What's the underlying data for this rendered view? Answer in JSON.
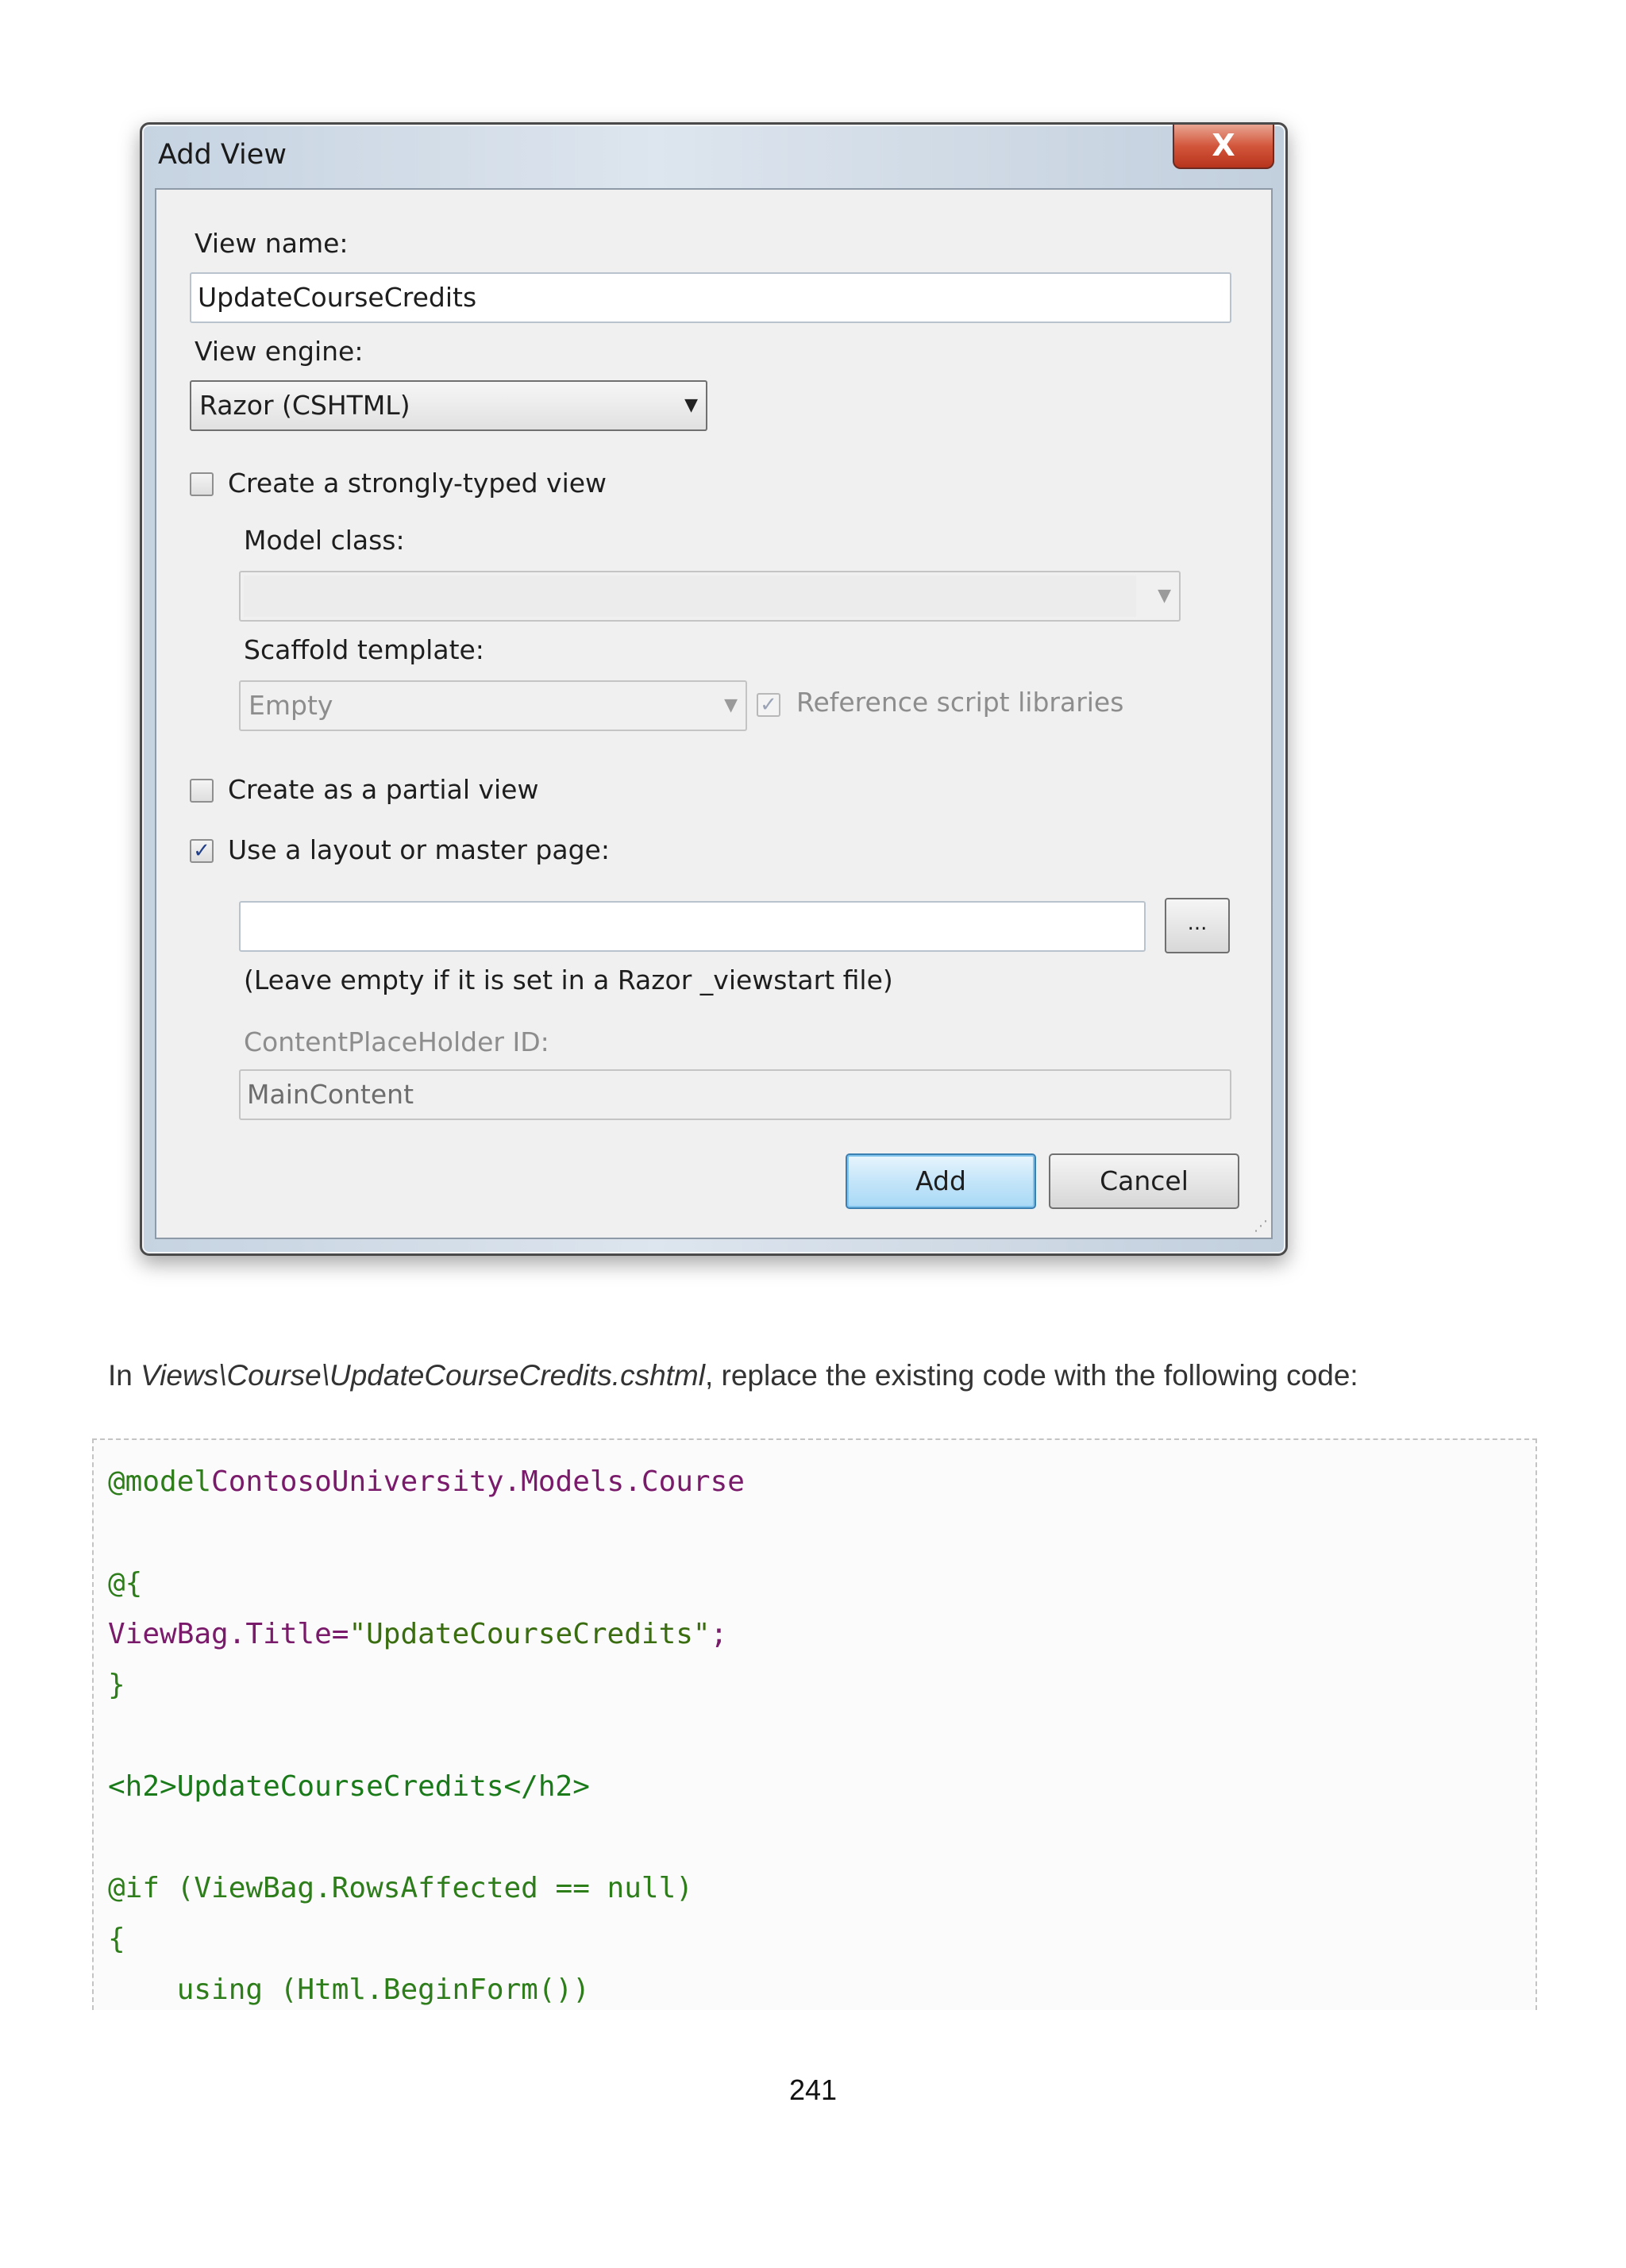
{
  "dialog": {
    "title": "Add View",
    "close_glyph": "X",
    "view_name_label": "View name:",
    "view_name_value": "UpdateCourseCredits",
    "view_engine_label": "View engine:",
    "view_engine_value": "Razor (CSHTML)",
    "strongly_typed_label": "Create a strongly-typed view",
    "strongly_typed_checked": false,
    "model_class_label": "Model class:",
    "model_class_value": "",
    "scaffold_label": "Scaffold template:",
    "scaffold_value": "Empty",
    "reference_scripts_label": "Reference script libraries",
    "reference_scripts_checked": true,
    "partial_view_label": "Create as a partial view",
    "partial_view_checked": false,
    "layout_label": "Use a layout or master page:",
    "layout_checked": true,
    "layout_value": "",
    "browse_label": "...",
    "layout_hint": "(Leave empty if it is set in a Razor _viewstart file)",
    "placeholder_id_label": "ContentPlaceHolder ID:",
    "placeholder_id_value": "MainContent",
    "add_label": "Add",
    "cancel_label": "Cancel",
    "checkmark": "✓"
  },
  "document": {
    "intro_prefix": "In ",
    "intro_path": "Views\\Course\\UpdateCourseCredits.cshtml",
    "intro_suffix": ", replace the existing code with the following code:",
    "code": {
      "l1_a": "@model",
      "l1_b": "ContosoUniversity.Models.Course",
      "l2": "@{",
      "l3_a": "ViewBag.Title=",
      "l3_b": "\"UpdateCourseCredits\"",
      "l3_c": ";",
      "l4": "}",
      "l5": "<h2>UpdateCourseCredits</h2>",
      "l6": "@if (ViewBag.RowsAffected == null)",
      "l7": "{",
      "l8": "    using (Html.BeginForm())"
    },
    "page_number": "241"
  }
}
